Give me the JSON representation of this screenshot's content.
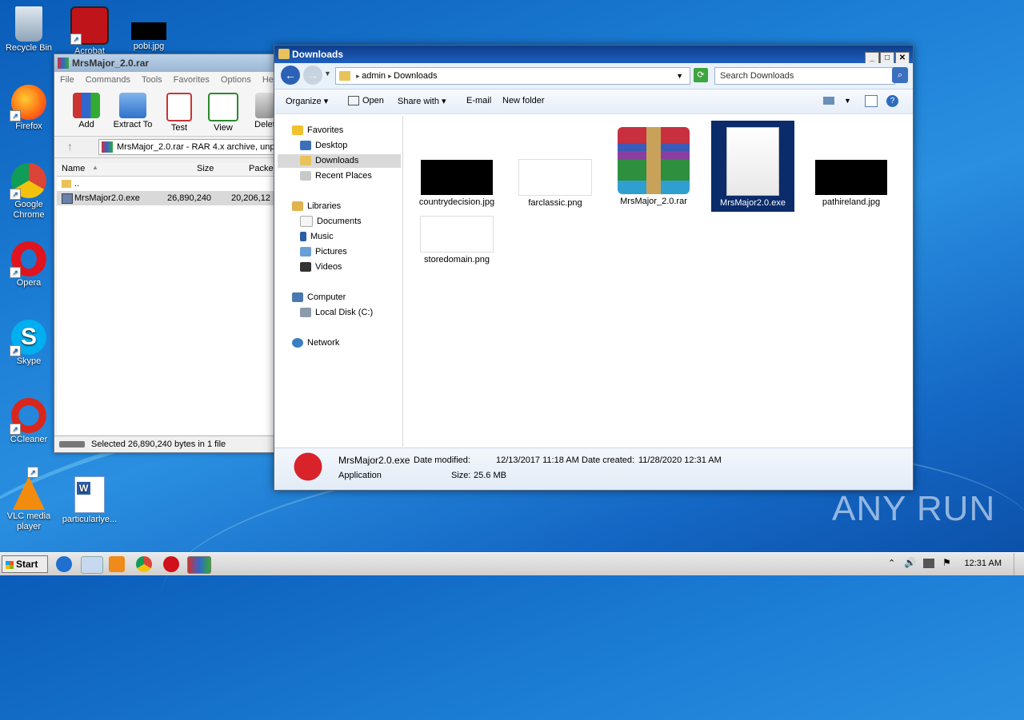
{
  "desktop": {
    "icons": [
      {
        "label": "Recycle Bin"
      },
      {
        "label": "Acrobat"
      },
      {
        "label": "pobi.jpg"
      },
      {
        "label": "Firefox"
      },
      {
        "label": "Google Chrome"
      },
      {
        "label": "Opera"
      },
      {
        "label": "Skype"
      },
      {
        "label": "CCleaner"
      },
      {
        "label": "VLC media player"
      },
      {
        "label": "particularlye..."
      }
    ],
    "watermark": "ANY RUN"
  },
  "winrar": {
    "title": "MrsMajor_2.0.rar",
    "menu": [
      "File",
      "Commands",
      "Tools",
      "Favorites",
      "Options",
      "Help"
    ],
    "toolbar": [
      "Add",
      "Extract To",
      "Test",
      "View",
      "Delet"
    ],
    "path": "MrsMajor_2.0.rar - RAR 4.x archive, unp",
    "columns": {
      "name": "Name",
      "size": "Size",
      "packed": "Packed"
    },
    "rows": [
      {
        "name": "..",
        "size": "",
        "packed": ""
      },
      {
        "name": "MrsMajor2.0.exe",
        "size": "26,890,240",
        "packed": "20,206,12"
      }
    ],
    "status": "Selected 26,890,240 bytes in 1 file"
  },
  "explorer": {
    "title": "Downloads",
    "breadcrumb": [
      "admin",
      "Downloads"
    ],
    "search_placeholder": "Search Downloads",
    "commands": {
      "organize": "Organize",
      "open": "Open",
      "share": "Share with",
      "email": "E-mail",
      "new_folder": "New folder"
    },
    "nav": {
      "favorites": "Favorites",
      "desktop": "Desktop",
      "downloads": "Downloads",
      "recent": "Recent Places",
      "libraries": "Libraries",
      "documents": "Documents",
      "music": "Music",
      "pictures": "Pictures",
      "videos": "Videos",
      "computer": "Computer",
      "localdisk": "Local Disk (C:)",
      "network": "Network"
    },
    "files": [
      {
        "name": "countrydecision.jpg"
      },
      {
        "name": "farclassic.png"
      },
      {
        "name": "MrsMajor_2.0.rar"
      },
      {
        "name": "MrsMajor2.0.exe"
      },
      {
        "name": "pathireland.jpg"
      },
      {
        "name": "storedomain.png"
      }
    ],
    "details": {
      "name": "MrsMajor2.0.exe",
      "type": "Application",
      "modified_label": "Date modified:",
      "modified": "12/13/2017 11:18 AM",
      "size_label": "Size:",
      "size": "25.6 MB",
      "created_label": "Date created:",
      "created": "11/28/2020 12:31 AM"
    }
  },
  "taskbar": {
    "start": "Start",
    "clock": "12:31 AM"
  }
}
